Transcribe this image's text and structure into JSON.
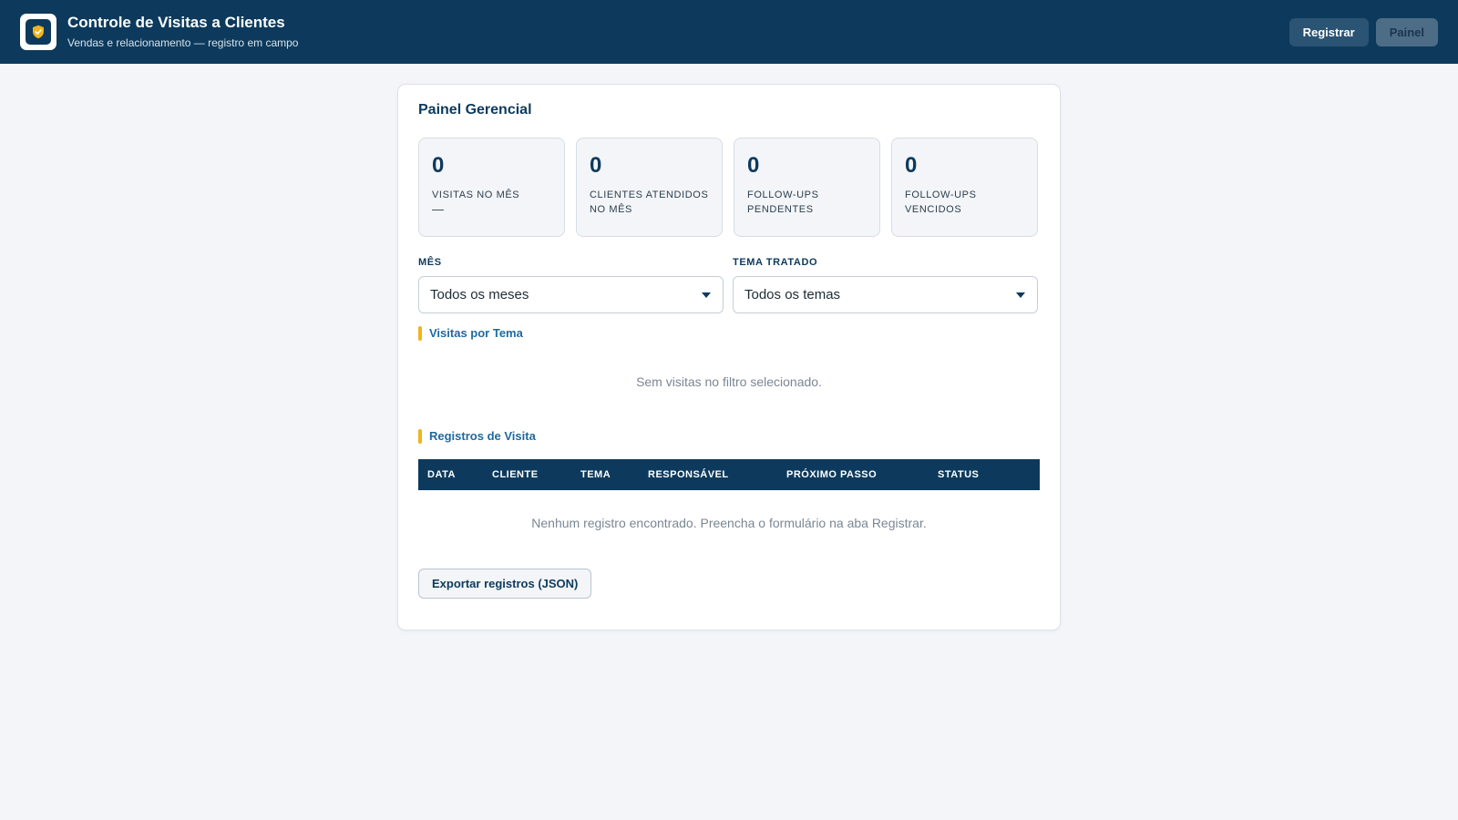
{
  "header": {
    "title": "Controle de Visitas a Clientes",
    "subtitle": "Vendas e relacionamento — registro em campo",
    "logo_icon": "shield-check-icon",
    "nav": {
      "registrar_label": "Registrar",
      "painel_label": "Painel"
    }
  },
  "dashboard": {
    "title": "Painel Gerencial",
    "kpis": [
      {
        "value": "0",
        "label": "VISITAS NO MÊS",
        "sub": "—"
      },
      {
        "value": "0",
        "label": "CLIENTES ATENDIDOS NO MÊS"
      },
      {
        "value": "0",
        "label": "FOLLOW-UPS PENDENTES"
      },
      {
        "value": "0",
        "label": "FOLLOW-UPS VENCIDOS"
      }
    ],
    "filters": {
      "month_label": "MÊS",
      "month_value": "Todos os meses",
      "topic_label": "TEMA TRATADO",
      "topic_value": "Todos os temas"
    },
    "topic_section": {
      "title": "Visitas por Tema",
      "empty": "Sem visitas no filtro selecionado."
    },
    "records_section": {
      "title": "Registros de Visita",
      "columns": [
        "DATA",
        "CLIENTE",
        "TEMA",
        "RESPONSÁVEL",
        "PRÓXIMO PASSO",
        "STATUS"
      ],
      "empty": "Nenhum registro encontrado. Preencha o formulário na aba Registrar."
    },
    "export_label": "Exportar registros (JSON)"
  },
  "colors": {
    "primary": "#0d3a5c",
    "accent": "#f0b41b",
    "link": "#1f6aa0",
    "background": "#f3f5f8"
  }
}
